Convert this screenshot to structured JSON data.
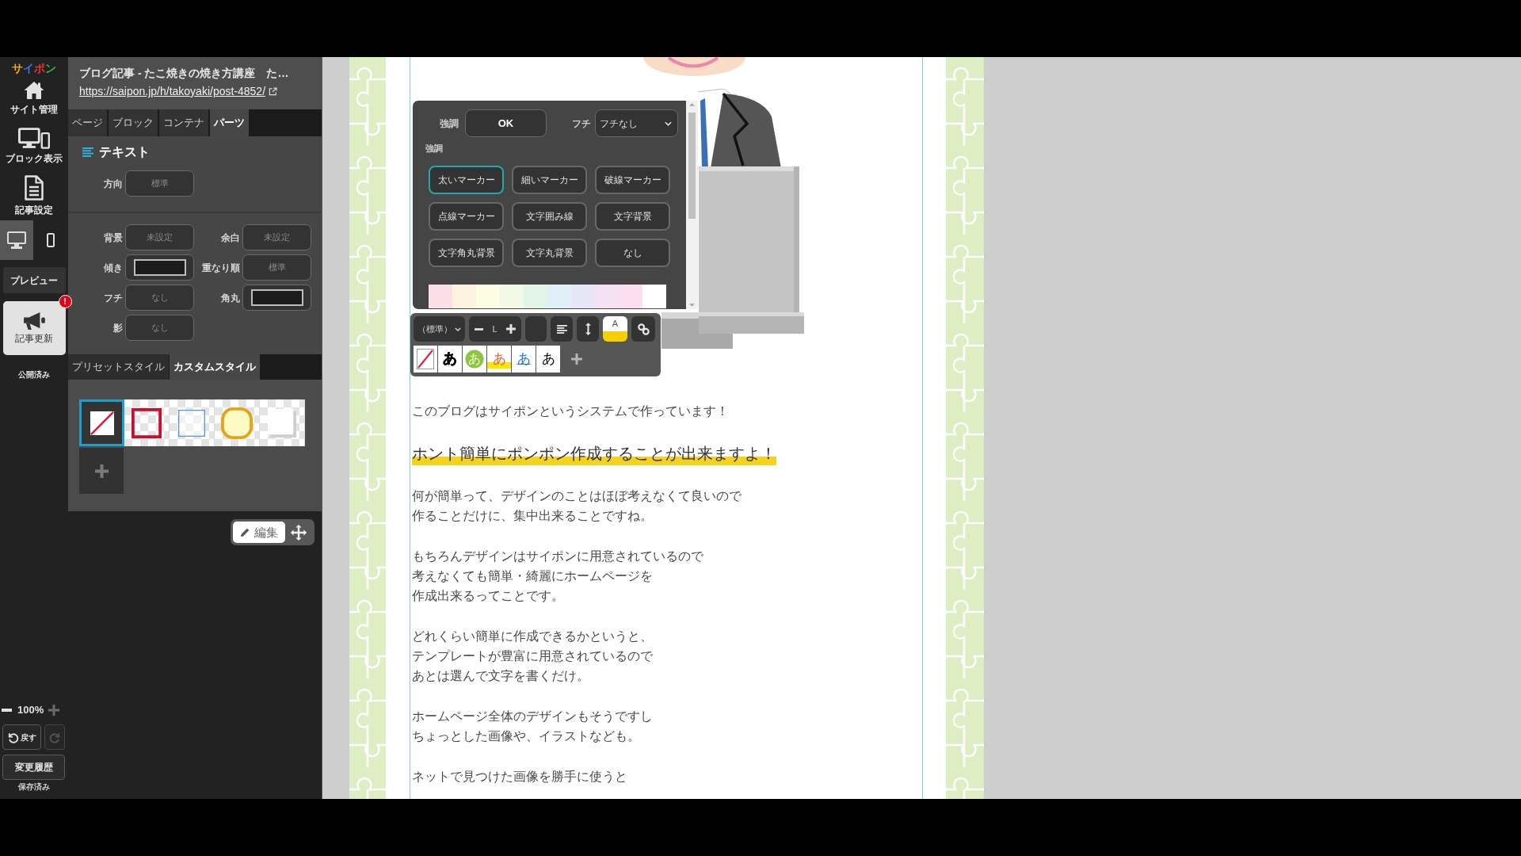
{
  "rail": {
    "logo": "サイポン",
    "nav": [
      {
        "label": "サイト管理"
      },
      {
        "label": "ブロック表示"
      },
      {
        "label": "記事設定"
      }
    ],
    "devices": [
      {
        "selected": true
      },
      {
        "selected": false
      }
    ],
    "preview_button": "プレビュー",
    "update_button": {
      "label": "記事更新",
      "badge": "!"
    },
    "publish_status": "公開済み",
    "zoom": "100%",
    "undo_button": "戻す",
    "redo_button": {
      "disabled": true
    },
    "history_button": "変更履歴",
    "save_status": "保存済み"
  },
  "panel": {
    "title": "ブログ記事 - たこ焼きの焼き方講座　た…",
    "url": "https://saipon.jp/h/takoyaki/post-4852/",
    "tabs": [
      {
        "label": "ページ",
        "selected": false
      },
      {
        "label": "ブロック",
        "selected": false
      },
      {
        "label": "コンテナ",
        "selected": false
      },
      {
        "label": "パーツ",
        "selected": true
      }
    ],
    "section_title": "テキスト",
    "direction": {
      "label": "方向",
      "value": "標準"
    },
    "properties": [
      {
        "kind": "text",
        "label": "背景",
        "value": "未設定"
      },
      {
        "kind": "text",
        "label": "余白",
        "value": "未設定"
      },
      {
        "kind": "box",
        "label": "傾き"
      },
      {
        "kind": "text",
        "label": "重なり順",
        "value": "標準"
      },
      {
        "kind": "text",
        "label": "フチ",
        "value": "なし"
      },
      {
        "kind": "box",
        "label": "角丸"
      },
      {
        "kind": "text",
        "label": "影",
        "value": "なし"
      }
    ],
    "style_tabs": [
      {
        "label": "プリセットスタイル",
        "selected": false
      },
      {
        "label": "カスタムスタイル",
        "selected": true
      }
    ],
    "custom_styles": [
      {
        "kind": "none",
        "selected": true
      },
      {
        "kind": "frame",
        "selected": false
      },
      {
        "kind": "thin",
        "selected": false
      },
      {
        "kind": "round",
        "selected": false
      },
      {
        "kind": "shadow",
        "selected": false
      }
    ],
    "edit_button": "編集"
  },
  "article": {
    "paragraphs": [
      {
        "kind": "plain",
        "lines": [
          "このブログはサイポンというシステムで作っています！"
        ]
      },
      {
        "kind": "marker",
        "lines": [
          "ホント簡単にポンポン作成することが出来ますよ！"
        ]
      },
      {
        "kind": "plain",
        "lines": [
          "何が簡単って、デザインのことはほぼ考えなくて良いので",
          "作ることだけに、集中出来ることですね。"
        ]
      },
      {
        "kind": "plain",
        "lines": [
          "もちろんデザインはサイポンに用意されているので",
          "考えなくても簡単・綺麗にホームページを",
          "作成出来るってことです。"
        ]
      },
      {
        "kind": "plain",
        "lines": [
          "どれくらい簡単に作成できるかというと、",
          "テンプレートが豊富に用意されているので",
          "あとは選んで文字を書くだけ。"
        ]
      },
      {
        "kind": "plain",
        "lines": [
          "ホームページ全体のデザインもそうですし",
          "ちょっとした画像や、イラストなども。"
        ]
      },
      {
        "kind": "plain",
        "lines": [
          "ネットで見つけた画像を勝手に使うと"
        ]
      }
    ]
  },
  "emphasis_popup": {
    "label": "強調",
    "ok_button": "OK",
    "border_label": "フチ",
    "border_select": "フチなし",
    "section_label": "強調",
    "options": [
      {
        "label": "太いマーカー",
        "selected": true
      },
      {
        "label": "細いマーカー",
        "selected": false
      },
      {
        "label": "破線マーカー",
        "selected": false
      },
      {
        "label": "点線マーカー",
        "selected": false
      },
      {
        "label": "文字囲み線",
        "selected": false
      },
      {
        "label": "文字背景",
        "selected": false
      },
      {
        "label": "文字角丸背景",
        "selected": false
      },
      {
        "label": "文字丸背景",
        "selected": false
      },
      {
        "label": "なし",
        "selected": false
      }
    ],
    "colors": [
      {
        "color": "#fbdfe6"
      },
      {
        "color": "#fdf1df"
      },
      {
        "color": "#fdfde3"
      },
      {
        "color": "#f2f9e6"
      },
      {
        "color": "#e2f5e8"
      },
      {
        "color": "#e1eff9"
      },
      {
        "color": "#e6e6f6"
      },
      {
        "color": "#f4e1f4"
      },
      {
        "color": "#fbdff0"
      },
      {
        "color": "#ffffff"
      }
    ]
  },
  "text_toolbar": {
    "font_select": "（標準）",
    "font_size": "L",
    "color_button": "A",
    "text_styles": [
      {
        "kind": "none"
      },
      {
        "kind": "outline",
        "label": "あ"
      },
      {
        "kind": "circle",
        "label": "あ"
      },
      {
        "kind": "marker",
        "label": "あ"
      },
      {
        "kind": "underline",
        "label": "あ"
      },
      {
        "kind": "plain",
        "label": "あ"
      }
    ]
  }
}
